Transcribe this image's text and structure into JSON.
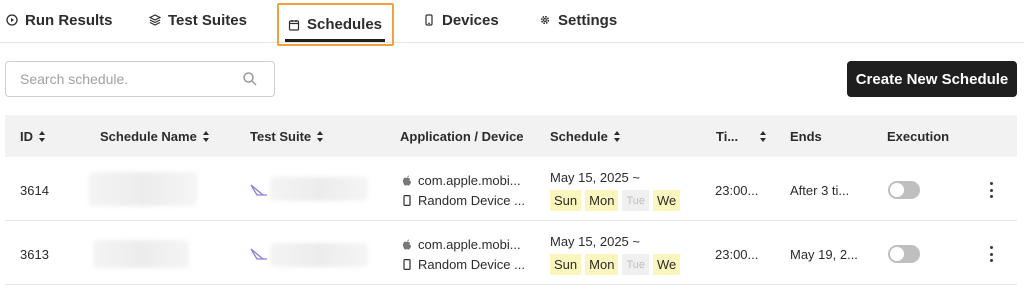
{
  "nav": {
    "tabs": [
      {
        "label": "Run Results",
        "icon": "play-circle-icon"
      },
      {
        "label": "Test Suites",
        "icon": "layers-icon"
      },
      {
        "label": "Schedules",
        "icon": "calendar-icon",
        "active": true
      },
      {
        "label": "Devices",
        "icon": "phone-icon"
      },
      {
        "label": "Settings",
        "icon": "gear-icon"
      }
    ],
    "active_highlight_color": "#f0a040"
  },
  "search": {
    "placeholder": "Search schedule.",
    "value": ""
  },
  "create_button": {
    "label": "Create New Schedule"
  },
  "table": {
    "headers": {
      "id": "ID",
      "name": "Schedule Name",
      "suite": "Test Suite",
      "app": "Application / Device",
      "schedule": "Schedule",
      "time": "Ti...",
      "ends": "Ends",
      "execution": "Execution"
    },
    "rows": [
      {
        "id": "3614",
        "app": "com.apple.mobi...",
        "device": "Random Device ...",
        "schedule_start": "May 15, 2025 ~",
        "days": [
          {
            "label": "Sun",
            "on": true
          },
          {
            "label": "Mon",
            "on": true
          },
          {
            "label": "Tue",
            "on": false
          },
          {
            "label": "We",
            "on": true
          }
        ],
        "time": "23:00...",
        "ends": "After 3 ti...",
        "execution_enabled": false
      },
      {
        "id": "3613",
        "app": "com.apple.mobi...",
        "device": "Random Device ...",
        "schedule_start": "May 15, 2025 ~",
        "days": [
          {
            "label": "Sun",
            "on": true
          },
          {
            "label": "Mon",
            "on": true
          },
          {
            "label": "Tue",
            "on": false
          },
          {
            "label": "We",
            "on": true
          }
        ],
        "time": "23:00...",
        "ends": "May 19, 2...",
        "execution_enabled": false
      }
    ]
  },
  "colors": {
    "primary_button": "#1f1f1f",
    "day_on_bg": "#fbf6bd",
    "day_off_bg": "#f0f0f0",
    "toggle_off": "#bfbfbf",
    "suite_icon": "#8a7fd8"
  }
}
